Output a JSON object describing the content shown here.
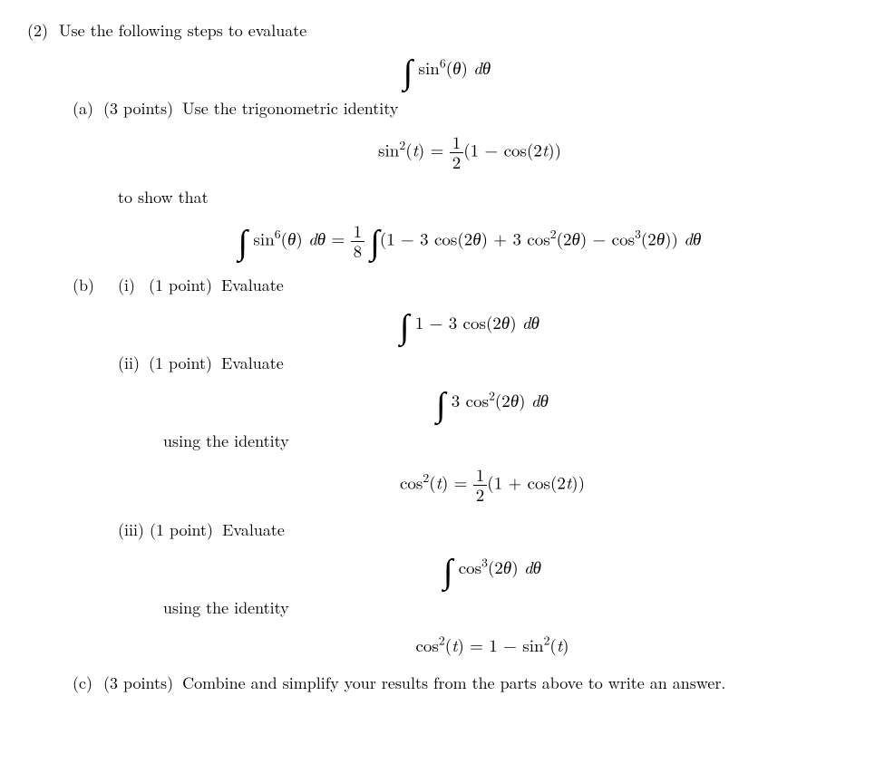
{
  "problem": {
    "number": "(2)",
    "intro": "Use the following steps to evaluate",
    "main_integral": "∫ sin⁶(θ) dθ"
  },
  "part_a": {
    "label": "(a)",
    "points": "(3 points)",
    "text1": "Use the trigonometric identity",
    "identity": "sin²(t) = ½(1 − cos(2t))",
    "text2": "to show that",
    "result": "∫ sin⁶(θ) dθ = (1/8) ∫ (1 − 3cos(2θ) + 3cos²(2θ) − cos³(2θ)) dθ"
  },
  "part_b": {
    "label": "(b)",
    "sub_i": {
      "label": "(i)",
      "points": "(1 point)",
      "text": "Evaluate",
      "integral": "∫ 1 − 3cos(2θ) dθ"
    },
    "sub_ii": {
      "label": "(ii)",
      "points": "(1 point)",
      "text": "Evaluate",
      "integral": "∫ 3cos²(2θ) dθ",
      "using": "using the identity",
      "identity": "cos²(t) = ½(1 + cos(2t))"
    },
    "sub_iii": {
      "label": "(iii)",
      "points": "(1 point)",
      "text": "Evaluate",
      "integral": "∫ cos³(2θ) dθ",
      "using": "using the identity",
      "identity": "cos²(t) = 1 − sin²(t)"
    }
  },
  "part_c": {
    "label": "(c)",
    "points": "(3 points)",
    "text": "Combine and simplify your results from the parts above to write an answer."
  }
}
